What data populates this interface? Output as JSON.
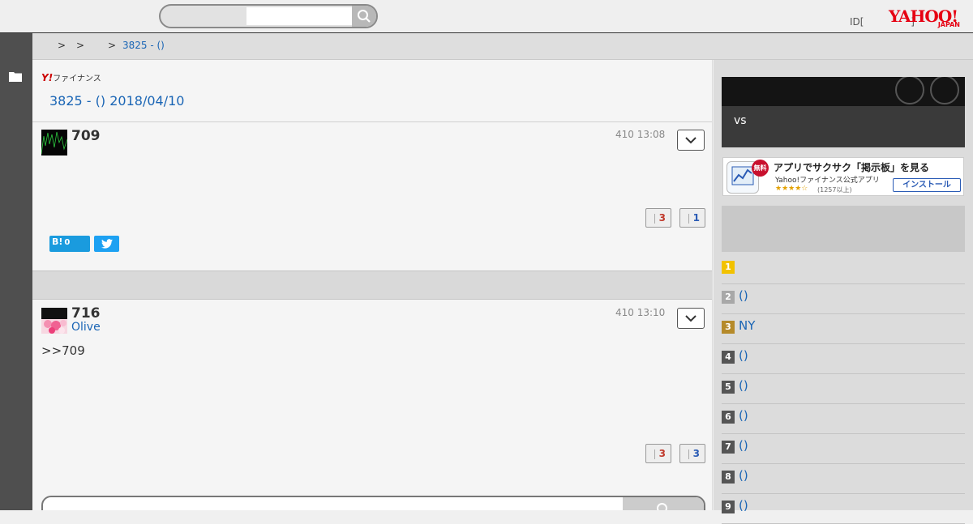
{
  "header": {
    "search_placeholder": "",
    "login_text": "ID[",
    "login_close": "]",
    "logo_text": "YAHOO!",
    "logo_sub": "JAPAN"
  },
  "breadcrumb": {
    "sep1": ">",
    "sep2": ">",
    "sep3": ">",
    "current": "3825 - ()"
  },
  "board": {
    "brand_y": "Y!",
    "brand_text": "ファイナンス",
    "title": "3825 - () 2018/04/10"
  },
  "posts": [
    {
      "number": "709",
      "user": "",
      "time": "410 13:08",
      "body": "",
      "likes": "3",
      "dislikes": "1"
    },
    {
      "number": "716",
      "user": "Olive",
      "time": "410 13:10",
      "body": ">>709",
      "likes": "3",
      "dislikes": "3"
    }
  ],
  "share": {
    "hatena_label": "B!",
    "hatena_count": "0"
  },
  "sidebar": {
    "promo_text": "vs",
    "app_ad": {
      "free_badge": "無料",
      "title": "アプリでサクサク「掲示板」を見る",
      "subtitle": "Yahoo!ファイナンス公式アプリ",
      "stars": "★★★★☆",
      "count": "(1257以上)",
      "install_label": "インストール"
    },
    "ranking": [
      {
        "rank": "1",
        "text": "",
        "color": "#f2c200"
      },
      {
        "rank": "2",
        "text": "()",
        "color": "#a8a8a8"
      },
      {
        "rank": "3",
        "text": "NY",
        "color": "#b58a2a"
      },
      {
        "rank": "4",
        "text": "()",
        "color": "#555555"
      },
      {
        "rank": "5",
        "text": "()",
        "color": "#555555"
      },
      {
        "rank": "6",
        "text": "()",
        "color": "#555555"
      },
      {
        "rank": "7",
        "text": "()",
        "color": "#555555"
      },
      {
        "rank": "8",
        "text": "()",
        "color": "#555555"
      },
      {
        "rank": "9",
        "text": "()",
        "color": "#555555"
      }
    ]
  },
  "colors": {
    "link": "#1a65b5",
    "like": "#c0392b",
    "dislike": "#2a5bb5",
    "rail": "#4f4f4f"
  }
}
